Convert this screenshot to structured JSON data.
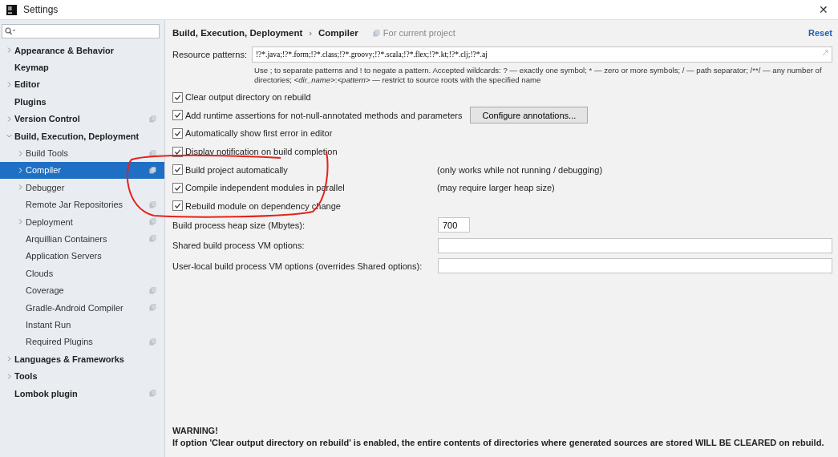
{
  "window": {
    "title": "Settings",
    "close": "✕"
  },
  "sidebar": {
    "items": [
      {
        "label": "Appearance & Behavior",
        "expanded": false,
        "selected": false,
        "scoped": false
      },
      {
        "label": "Keymap",
        "selected": false,
        "scoped": false
      },
      {
        "label": "Editor",
        "expanded": false,
        "selected": false,
        "scoped": false
      },
      {
        "label": "Plugins",
        "selected": false,
        "scoped": false
      },
      {
        "label": "Version Control",
        "expanded": false,
        "selected": false,
        "scoped": true
      },
      {
        "label": "Build, Execution, Deployment",
        "expanded": true,
        "selected": false,
        "scoped": false,
        "children": [
          {
            "label": "Build Tools",
            "expanded": false,
            "selected": false,
            "scoped": true
          },
          {
            "label": "Compiler",
            "expanded": false,
            "selected": true,
            "scoped": true
          },
          {
            "label": "Debugger",
            "expanded": false,
            "selected": false,
            "scoped": false
          },
          {
            "label": "Remote Jar Repositories",
            "selected": false,
            "scoped": true
          },
          {
            "label": "Deployment",
            "expanded": false,
            "selected": false,
            "scoped": true
          },
          {
            "label": "Arquillian Containers",
            "selected": false,
            "scoped": true
          },
          {
            "label": "Application Servers",
            "selected": false,
            "scoped": false
          },
          {
            "label": "Clouds",
            "selected": false,
            "scoped": false
          },
          {
            "label": "Coverage",
            "selected": false,
            "scoped": true
          },
          {
            "label": "Gradle-Android Compiler",
            "selected": false,
            "scoped": true
          },
          {
            "label": "Instant Run",
            "selected": false,
            "scoped": false
          },
          {
            "label": "Required Plugins",
            "selected": false,
            "scoped": true
          }
        ]
      },
      {
        "label": "Languages & Frameworks",
        "expanded": false,
        "selected": false,
        "scoped": false
      },
      {
        "label": "Tools",
        "expanded": false,
        "selected": false,
        "scoped": false
      },
      {
        "label": "Lombok plugin",
        "selected": false,
        "scoped": true
      }
    ]
  },
  "content": {
    "breadcrumb": [
      "Build, Execution, Deployment",
      "Compiler"
    ],
    "breadcrumb_separator": "›",
    "scope_note": "For current project",
    "reset": "Reset",
    "resource_patterns": {
      "label": "Resource patterns:",
      "value": "!?*.java;!?*.form;!?*.class;!?*.groovy;!?*.scala;!?*.flex;!?*.kt;!?*.clj;!?*.aj"
    },
    "hint": [
      {
        "text": "Use ; to separate patterns and ! to negate a pattern. Accepted wildcards: ? — exactly one symbol; * — zero or more symbols; / — path separator; /**/ — any number of directories; ",
        "kind": "plain"
      },
      {
        "text": "<dir_name>",
        "kind": "italic"
      },
      {
        "text": ":",
        "kind": "plain"
      },
      {
        "text": "<pattern>",
        "kind": "italic"
      },
      {
        "text": " — restrict to source roots with the specified name",
        "kind": "plain"
      }
    ],
    "options": [
      {
        "label": "Clear output directory on rebuild",
        "checked": true
      },
      {
        "label": "Add runtime assertions for not-null-annotated methods and parameters",
        "checked": true,
        "button": "Configure annotations..."
      },
      {
        "label": "Automatically show first error in editor",
        "checked": true
      },
      {
        "label": "Display notification on build completion",
        "checked": true
      },
      {
        "label": "Build project automatically",
        "checked": true,
        "note": "(only works while not running / debugging)"
      },
      {
        "label": "Compile independent modules in parallel",
        "checked": true,
        "note": "(may require larger heap size)"
      },
      {
        "label": "Rebuild module on dependency change",
        "checked": true
      }
    ],
    "fields": [
      {
        "label": "Build process heap size (Mbytes):",
        "value": "700",
        "kind": "short"
      },
      {
        "label": "Shared build process VM options:",
        "kind": "wide"
      },
      {
        "label": "User-local build process VM options (overrides Shared options):",
        "kind": "wide"
      }
    ],
    "warning": {
      "title": "WARNING!",
      "text": "If option 'Clear output directory on rebuild' is enabled, the entire contents of directories where generated sources are stored WILL BE CLEARED on rebuild."
    }
  }
}
